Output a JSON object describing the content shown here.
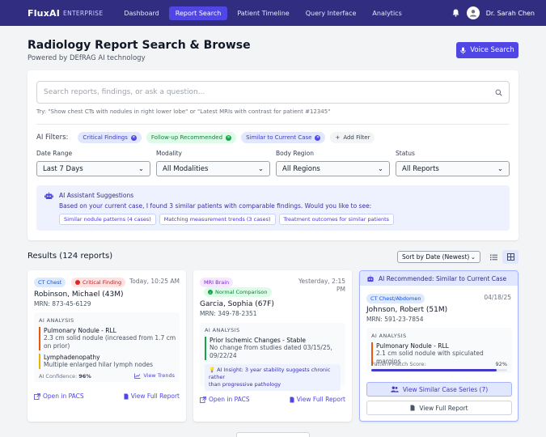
{
  "nav": {
    "brand": "FluxAI",
    "brand_sub": "ENTERPRISE",
    "links": [
      {
        "label": "Dashboard"
      },
      {
        "label": "Report Search"
      },
      {
        "label": "Patient Timeline"
      },
      {
        "label": "Query Interface"
      },
      {
        "label": "Analytics"
      }
    ],
    "user": "Dr. Sarah Chen"
  },
  "header": {
    "title": "Radiology Report Search & Browse",
    "subtitle": "Powered by DEfRAG AI technology",
    "voice_button": "Voice Search"
  },
  "search": {
    "placeholder": "Search reports, findings, or ask a question...",
    "hint": "Try: \"Show chest CTs with nodules in right lower lobe\" or \"Latest MRIs with contrast for patient #12345\""
  },
  "filters": {
    "label": "AI Filters:",
    "chips": [
      "Critical Findings",
      "Follow-up Recommended",
      "Similar to Current Case"
    ],
    "add_label": "Add Filter",
    "selects": [
      {
        "label": "Date Range",
        "value": "Last 7 Days"
      },
      {
        "label": "Modality",
        "value": "All Modalities"
      },
      {
        "label": "Body Region",
        "value": "All Regions"
      },
      {
        "label": "Status",
        "value": "All Reports"
      }
    ]
  },
  "ai_suggest": {
    "title": "AI Assistant Suggestions",
    "text": "Based on your current case, I found 3 similar patients with comparable findings. Would you like to see:",
    "pills": [
      "Similar nodule patterns (4 cases)",
      "Matching measurement trends (3 cases)",
      "Treatment outcomes for similar patients"
    ]
  },
  "results": {
    "title": "Results (124 reports)",
    "sort": "Sort by Date (Newest)"
  },
  "cards": [
    {
      "modality": "CT Chest",
      "flag": "Critical Finding",
      "date": "Today, 10:25 AM",
      "name": "Robinson, Michael (43M)",
      "mrn": "MRN: 873-45-6129",
      "analysis_title": "AI ANALYSIS",
      "findings": [
        {
          "title": "Pulmonary Nodule - RLL",
          "desc1": "2.3 cm solid nodule (increased from 1.7 cm",
          "desc2": "on prior)"
        },
        {
          "title": "Lymphadenopathy",
          "desc1": "Multiple enlarged hilar lymph nodes"
        }
      ],
      "confidence_label": "AI Confidence:",
      "confidence": "96%",
      "trends": "View Trends",
      "pacs": "Open in PACS",
      "full": "View Full Report"
    },
    {
      "modality": "MRI Brain",
      "flag": "Normal Comparison",
      "date1": "Yesterday, 2:15",
      "date2": "PM",
      "name": "Garcia, Sophia (67F)",
      "mrn": "MRN: 349-78-2351",
      "analysis_title": "AI ANALYSIS",
      "findings": [
        {
          "title": "Prior Ischemic Changes - Stable",
          "desc1": "No change from studies dated 03/15/25,",
          "desc2": "09/22/24"
        }
      ],
      "insight1": "AI Insight: 3 year stability suggests chronic rather",
      "insight2": "than progressive pathology",
      "pacs": "Open in PACS",
      "full": "View Full Report"
    },
    {
      "header": "AI Recommended: Similar to Current Case",
      "modality": "CT Chest/Abdomen",
      "date": "04/18/25",
      "name": "Johnson, Robert (51M)",
      "mrn": "MRN: 591-23-7854",
      "analysis_title": "AI ANALYSIS",
      "findings": [
        {
          "title": "Pulmonary Nodule - RLL",
          "desc1": "2.1 cm solid nodule with spiculated margins"
        }
      ],
      "match_label": "Pattern Match Score:",
      "match": "92%",
      "match_value": 0.92,
      "similar_btn": "View Similar Case Series (7)",
      "full": "View Full Report"
    }
  ]
}
